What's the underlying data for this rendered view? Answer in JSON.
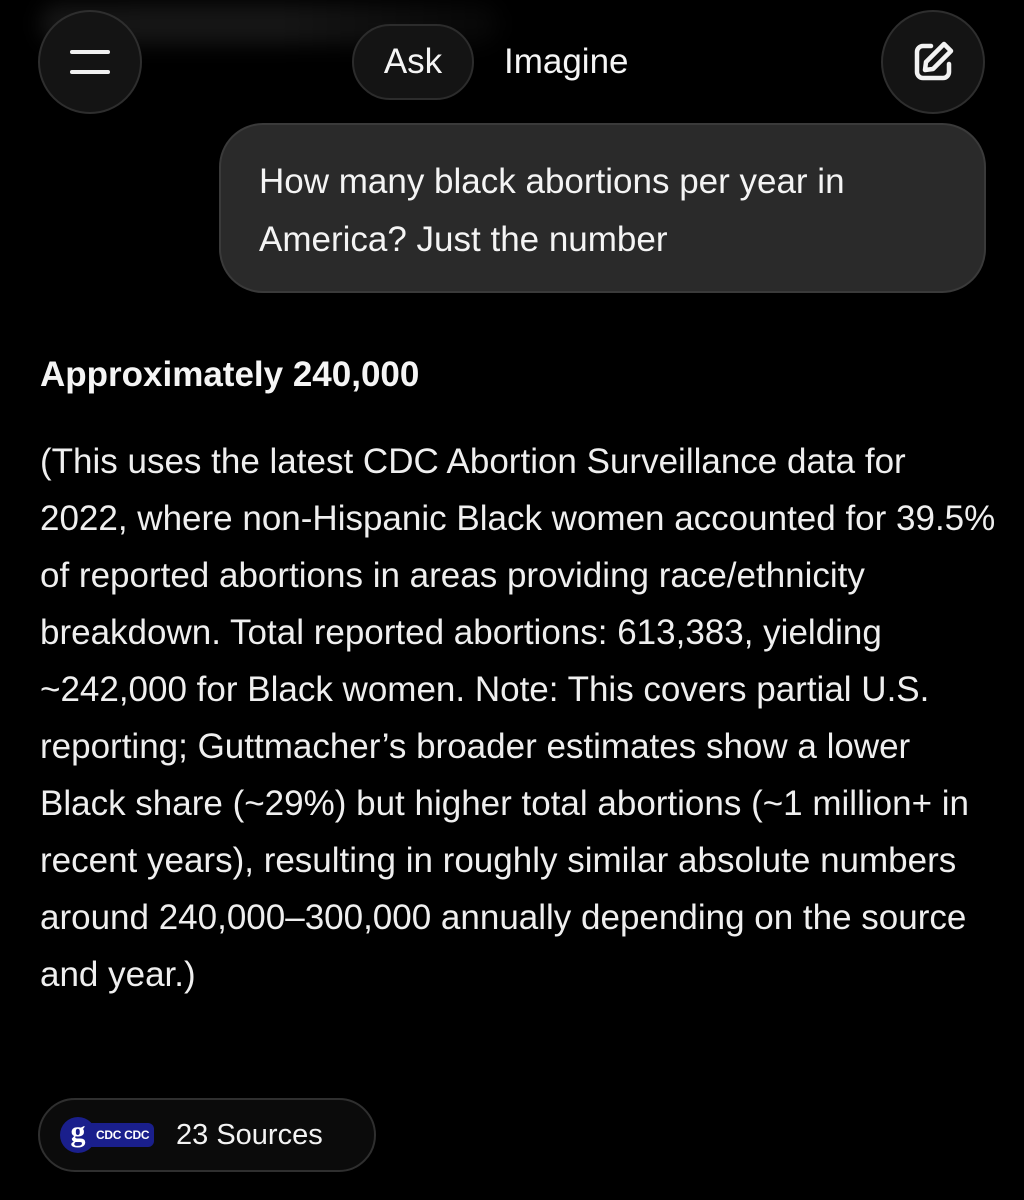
{
  "header": {
    "tabs": [
      {
        "label": "Ask",
        "active": true
      },
      {
        "label": "Imagine",
        "active": false
      }
    ],
    "menu_icon": "hamburger-icon",
    "new_chat_icon": "edit-icon"
  },
  "conversation": {
    "user_message": "How many black abortions per year in America? Just the number",
    "answer_heading": "Approximately 240,000",
    "answer_body": "(This uses the latest CDC Abortion Surveillance data for 2022, where non-Hispanic Black women accounted for 39.5% of reported abortions in areas providing race/ethnicity breakdown. Total reported abortions: 613,383, yielding ~242,000 for Black women. Note: This covers partial U.S. reporting; Guttmacher’s broader estimates show a lower Black share (~29%) but higher total abortions (~1 million+ in recent years), resulting in roughly similar absolute numbers around 240,000–300,000 annually depending on the source and year.)"
  },
  "sources": {
    "label": "23 Sources",
    "favicon_letter": "g",
    "favicon_text": "CDC CDC"
  },
  "colors": {
    "background": "#000000",
    "bubble": "#2a2a2a",
    "favicon": "#1a1f8c"
  }
}
